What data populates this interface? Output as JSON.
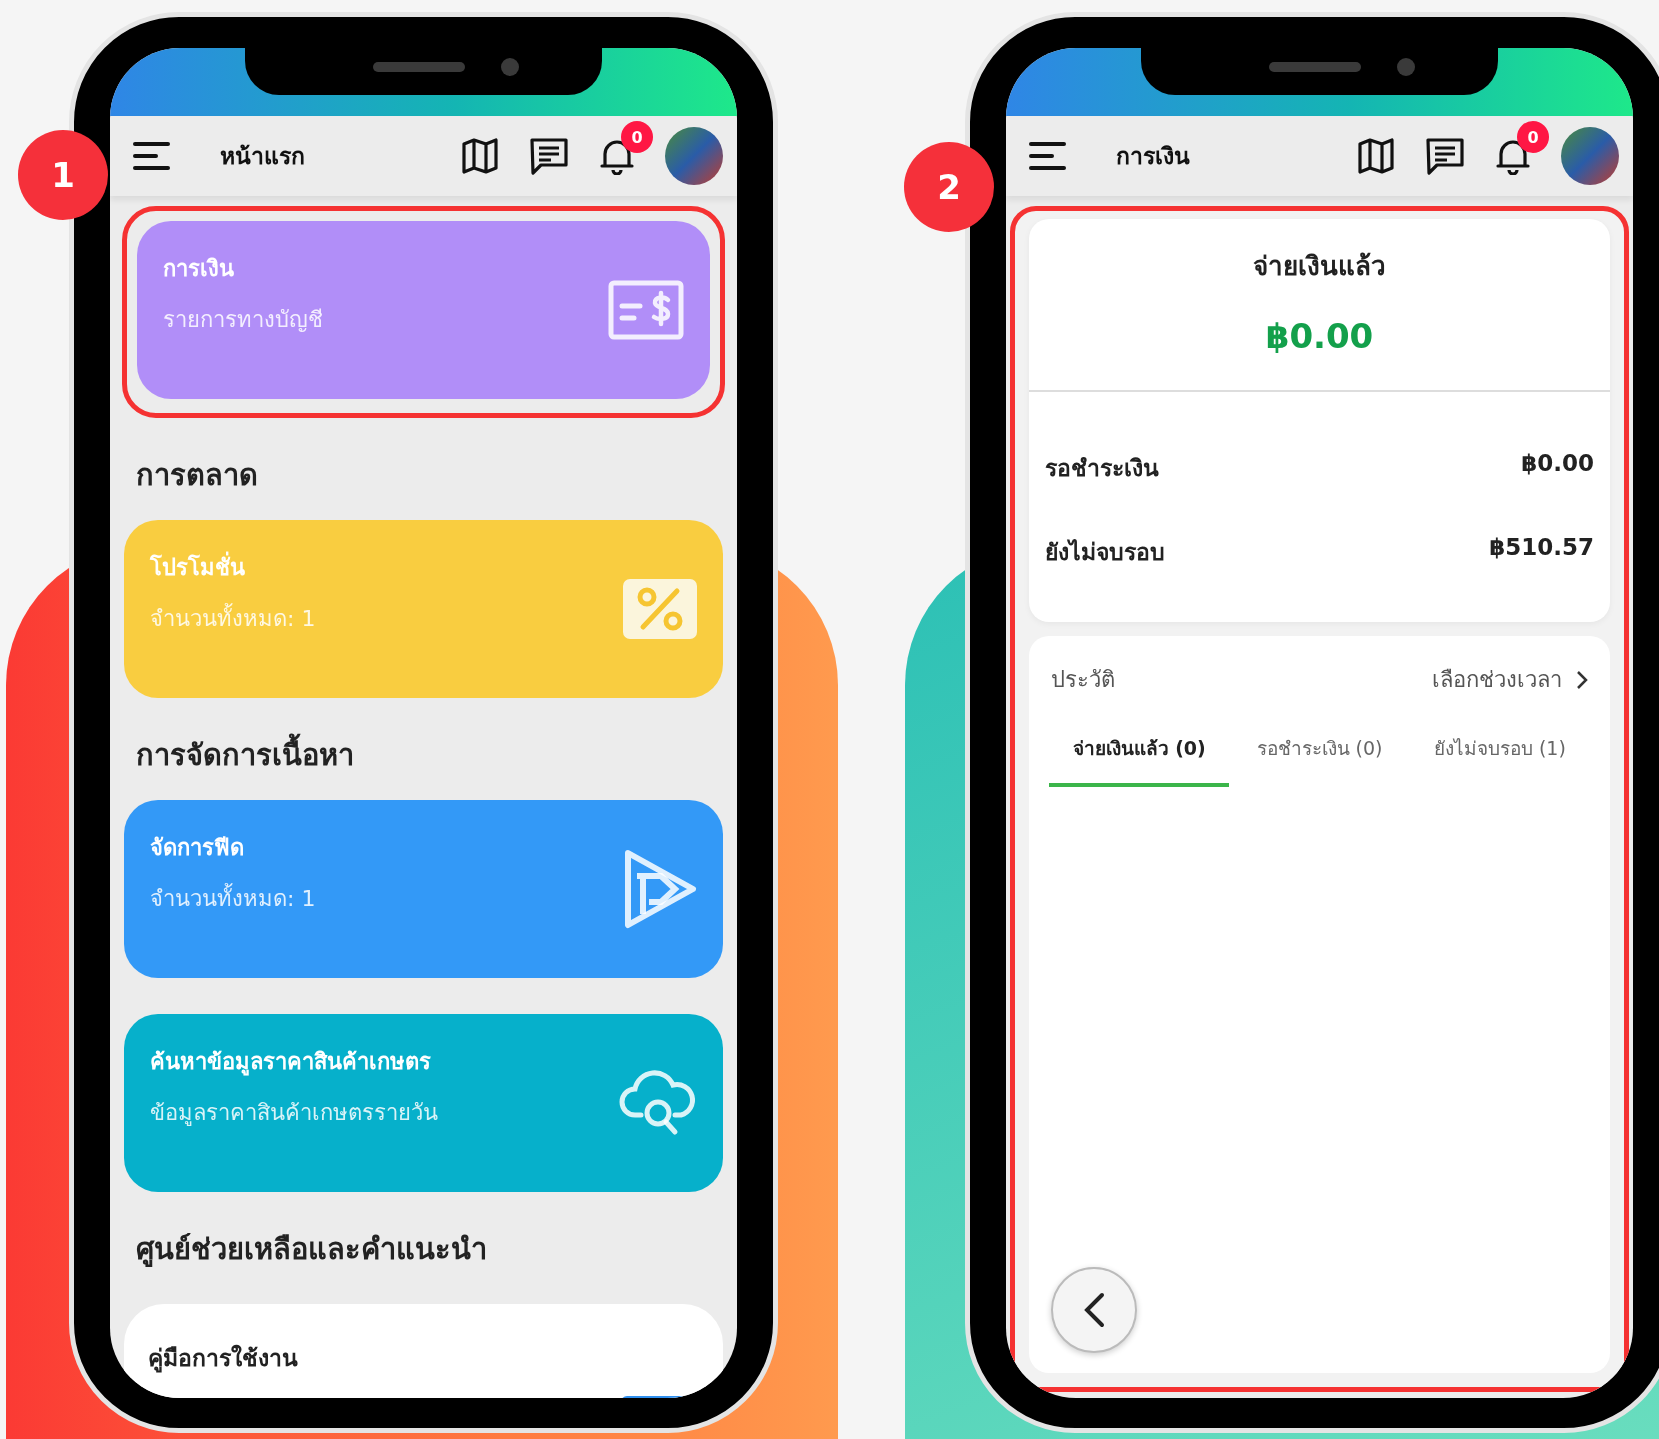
{
  "home_screen": {
    "step": "1",
    "title": "หน้าแรก",
    "notification_count": "0",
    "items": [
      {
        "kind": "card",
        "title": "การเงิน",
        "subtitle": "รายการทางบัญชี",
        "color": "#b18ef8",
        "highlighted": true
      },
      {
        "kind": "heading",
        "text": "การตลาด"
      },
      {
        "kind": "card",
        "title": "โปรโมชั่น",
        "subtitle": "จำนวนทั้งหมด: 1",
        "color": "#f9cd40",
        "highlighted": false
      },
      {
        "kind": "heading",
        "text": "การจัดการเนื้อหา"
      },
      {
        "kind": "card",
        "title": "จัดการฟีด",
        "subtitle": "จำนวนทั้งหมด: 1",
        "color": "#3399f7",
        "highlighted": false
      },
      {
        "kind": "card",
        "title": "ค้นหาข้อมูลราคาสินค้าเกษตร",
        "subtitle": "ข้อมูลราคาสินค้าเกษตรรายวัน",
        "color": "#06b0cb",
        "highlighted": false
      },
      {
        "kind": "heading",
        "text": "ศูนย์ช่วยเหลือและคำแนะนำ"
      },
      {
        "kind": "guide",
        "title": "คู่มือการใช้งาน"
      }
    ]
  },
  "finance_screen": {
    "step": "2",
    "title": "การเงิน",
    "notification_count": "0",
    "highlighted": true,
    "summary": {
      "label": "จ่ายเงินแล้ว",
      "amount": "฿0.00",
      "rows": [
        {
          "label": "รอชำระเงิน",
          "value": "฿0.00"
        },
        {
          "label": "ยังไม่จบรอบ",
          "value": "฿510.57"
        }
      ]
    },
    "history": {
      "title": "ประวัติ",
      "range_link": "เลือกช่วงเวลา",
      "tabs": [
        {
          "label": "จ่ายเงินแล้ว (0)",
          "selected": true
        },
        {
          "label": "รอชำระเงิน (0)",
          "selected": false
        },
        {
          "label": "ยังไม่จบรอบ (1)",
          "selected": false
        }
      ]
    }
  }
}
